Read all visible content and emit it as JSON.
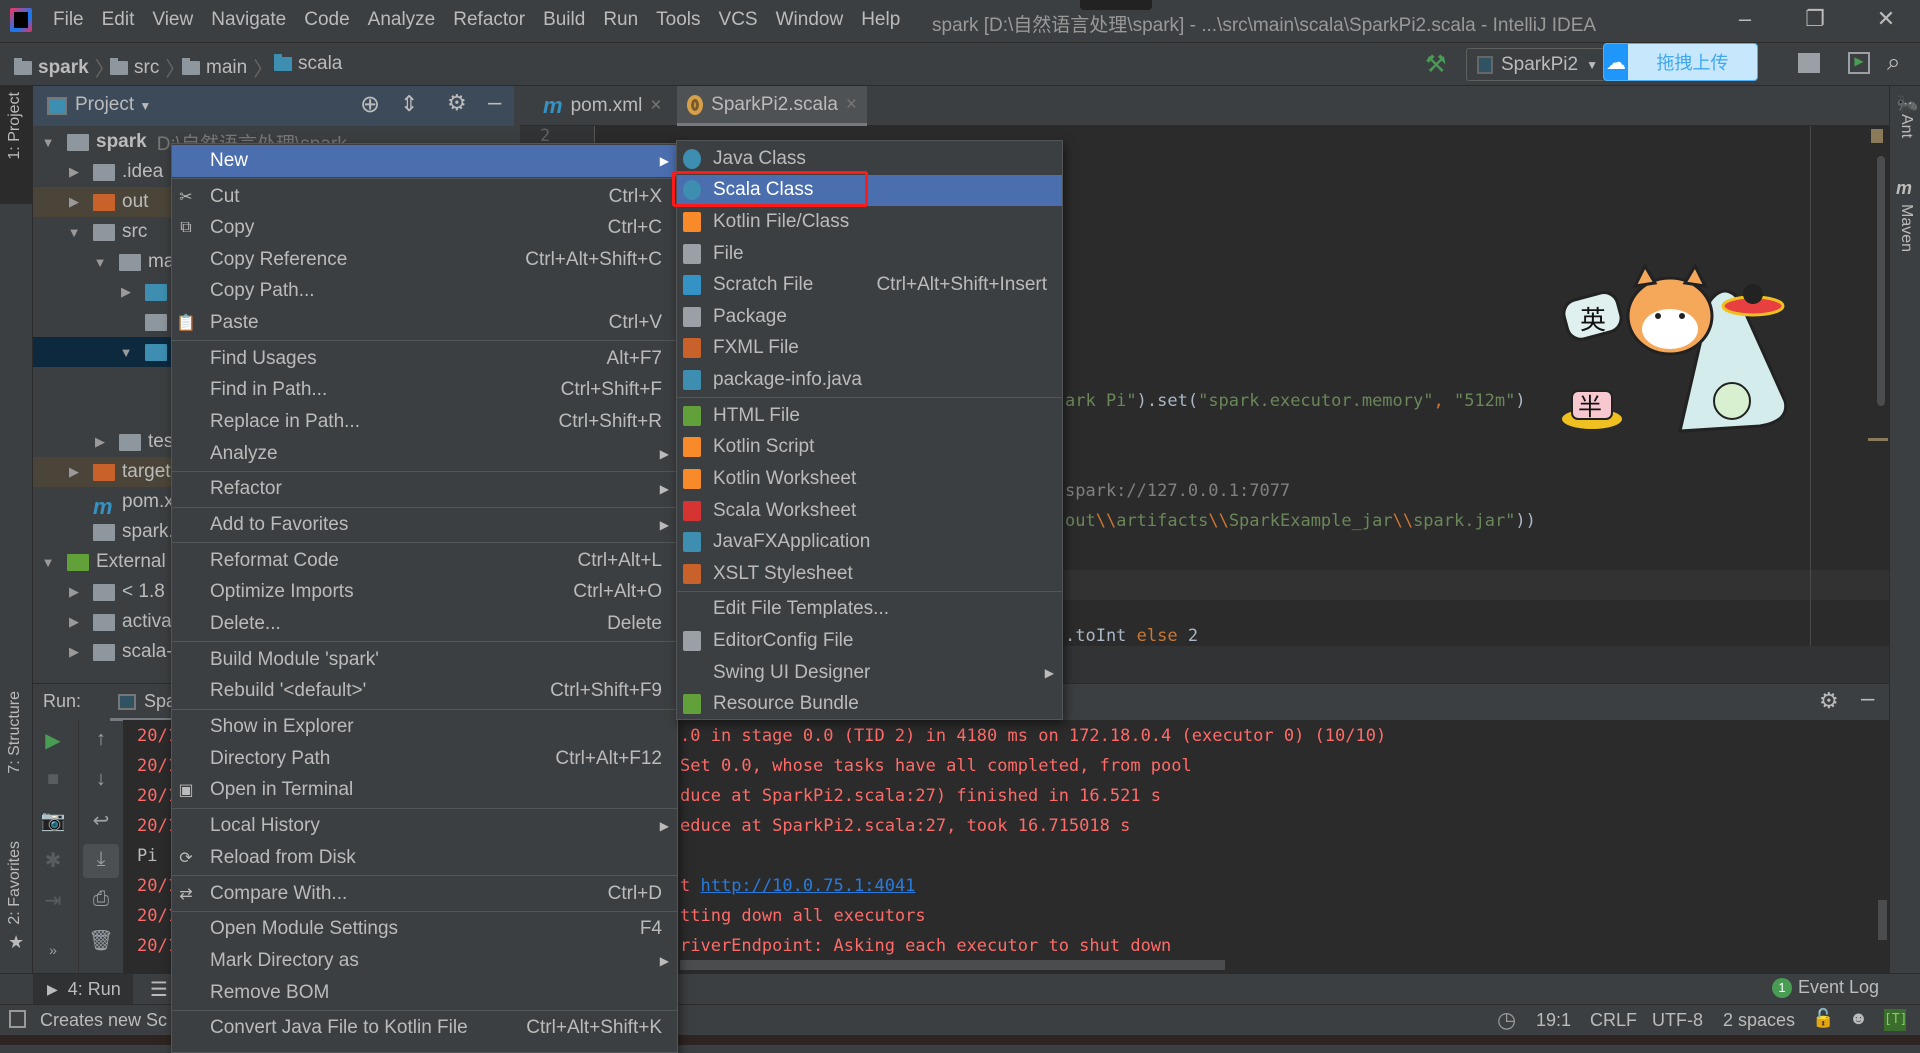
{
  "titlebar": {
    "menu": [
      "File",
      "Edit",
      "View",
      "Navigate",
      "Code",
      "Analyze",
      "Refactor",
      "Build",
      "Run",
      "Tools",
      "VCS",
      "Window",
      "Help"
    ],
    "title": "spark [D:\\自然语言处理\\spark] - ...\\src\\main\\scala\\SparkPi2.scala - IntelliJ IDEA",
    "controls": {
      "minimize": "–",
      "restore": "❐",
      "close": "✕"
    }
  },
  "navbar": {
    "breadcrumbs": [
      "spark",
      "src",
      "main",
      "scala"
    ],
    "run_config": "SparkPi2",
    "upload_button": "拖拽上传"
  },
  "left_stripe": {
    "project": "1: Project",
    "structure": "7: Structure",
    "favorites": "2: Favorites"
  },
  "right_stripe": {
    "ant": "Ant",
    "maven": "Maven"
  },
  "project_panel": {
    "title": "Project",
    "tree": [
      {
        "label": "spark",
        "suffix": "D:\\自然语言处理\\spark",
        "depth": 0,
        "expanded": true,
        "icon": "module-folder",
        "bold": true
      },
      {
        "label": ".idea",
        "depth": 1,
        "expanded": false,
        "icon": "folder"
      },
      {
        "label": "out",
        "depth": 1,
        "expanded": false,
        "icon": "excluded-folder",
        "excluded": true
      },
      {
        "label": "src",
        "depth": 1,
        "expanded": true,
        "icon": "folder"
      },
      {
        "label": "ma",
        "depth": 2,
        "expanded": true,
        "icon": "folder"
      },
      {
        "label": "",
        "depth": 3,
        "expanded": false,
        "icon": "source-folder"
      },
      {
        "label": "",
        "depth": 3,
        "icon": "resources-folder"
      },
      {
        "label": "",
        "depth": 3,
        "expanded": true,
        "icon": "source-folder",
        "selected": true
      },
      {
        "label": "",
        "depth": 4,
        "icon": "none"
      },
      {
        "label": "",
        "depth": 4,
        "icon": "none"
      },
      {
        "label": "tes",
        "depth": 2,
        "expanded": false,
        "icon": "folder"
      },
      {
        "label": "target",
        "depth": 1,
        "expanded": false,
        "icon": "excluded-folder",
        "excluded": true
      },
      {
        "label": "pom.xm",
        "depth": 1,
        "icon": "maven-file"
      },
      {
        "label": "spark.",
        "depth": 1,
        "icon": "iml-file"
      },
      {
        "label": "External L",
        "depth": 0,
        "expanded": true,
        "icon": "libraries"
      },
      {
        "label": "< 1.8 :",
        "depth": 1,
        "expanded": false,
        "icon": "jdk"
      },
      {
        "label": "activa",
        "depth": 1,
        "expanded": false,
        "icon": "library"
      },
      {
        "label": "scala-",
        "depth": 1,
        "expanded": false,
        "icon": "library"
      }
    ]
  },
  "editor": {
    "tabs": [
      {
        "label": "pom.xml",
        "icon": "maven-icon",
        "active": false
      },
      {
        "label": "SparkPi2.scala",
        "icon": "scala-object-icon",
        "active": true
      }
    ],
    "line_number": "2",
    "code_lines": [
      [
        {
          "t": "ark Pi\"",
          "k": "str"
        },
        {
          "t": ").set(",
          "k": ""
        },
        {
          "t": "\"spark.executor.memory\"",
          "k": "str"
        },
        {
          "t": ", ",
          "k": "kw"
        },
        {
          "t": "\"512m\"",
          "k": "str"
        },
        {
          "t": ")",
          "k": ""
        }
      ],
      [
        {
          "t": "spark://127.0.0.1:7077",
          "k": "cm"
        }
      ],
      [
        {
          "t": "out",
          "k": "str"
        },
        {
          "t": "\\\\",
          "k": "kw"
        },
        {
          "t": "artifacts",
          "k": "str"
        },
        {
          "t": "\\\\",
          "k": "kw"
        },
        {
          "t": "SparkExample_jar",
          "k": "str"
        },
        {
          "t": "\\\\",
          "k": "kw"
        },
        {
          "t": "spark.jar\"",
          "k": "str"
        },
        {
          "t": "))",
          "k": ""
        }
      ],
      [
        {
          "t": ".toInt ",
          "k": ""
        },
        {
          "t": "else ",
          "k": "kw"
        },
        {
          "t": "2",
          "k": ""
        }
      ]
    ],
    "mascot_text": [
      "英",
      "半"
    ]
  },
  "run_panel": {
    "label": "Run:",
    "tab": "Spa",
    "console_left": [
      "20/1",
      "20/1",
      "20/1",
      "20/1",
      "Pi :",
      "20/1",
      "20/1",
      "20/1"
    ],
    "console_right": [
      ".0 in stage 0.0 (TID 2) in 4180 ms on 172.18.0.4 (executor 0) (10/10)",
      "Set 0.0, whose tasks have all completed, from pool",
      "duce at SparkPi2.scala:27) finished in 16.521 s",
      "educe at SparkPi2.scala:27, took 16.715018 s",
      "",
      "t ",
      "tting down all executors",
      "riverEndpoint: Asking each executor to shut down"
    ],
    "console_link": "http://10.0.75.1:4041"
  },
  "bottom_bar": {
    "run_tab": "4: Run",
    "event_log": "Event Log",
    "event_count": "1"
  },
  "status_bar": {
    "message": "Creates new Sc",
    "position": "19:1",
    "line_sep": "CRLF",
    "encoding": "UTF-8",
    "indent": "2 spaces"
  },
  "context_menu": {
    "items": [
      {
        "label": "New",
        "submenu": true,
        "highlighted": true
      },
      {
        "sep": true
      },
      {
        "label": "Cut",
        "shortcut": "Ctrl+X",
        "icon": "✂"
      },
      {
        "label": "Copy",
        "shortcut": "Ctrl+C",
        "icon": "⧉"
      },
      {
        "label": "Copy Reference",
        "shortcut": "Ctrl+Alt+Shift+C"
      },
      {
        "label": "Copy Path..."
      },
      {
        "label": "Paste",
        "shortcut": "Ctrl+V",
        "icon": "📋"
      },
      {
        "sep": true
      },
      {
        "label": "Find Usages",
        "shortcut": "Alt+F7"
      },
      {
        "label": "Find in Path...",
        "shortcut": "Ctrl+Shift+F"
      },
      {
        "label": "Replace in Path...",
        "shortcut": "Ctrl+Shift+R"
      },
      {
        "label": "Analyze",
        "submenu": true
      },
      {
        "sep": true
      },
      {
        "label": "Refactor",
        "submenu": true
      },
      {
        "sep": true
      },
      {
        "label": "Add to Favorites",
        "submenu": true
      },
      {
        "sep": true
      },
      {
        "label": "Reformat Code",
        "shortcut": "Ctrl+Alt+L"
      },
      {
        "label": "Optimize Imports",
        "shortcut": "Ctrl+Alt+O"
      },
      {
        "label": "Delete...",
        "shortcut": "Delete"
      },
      {
        "sep": true
      },
      {
        "label": "Build Module 'spark'"
      },
      {
        "label": "Rebuild '<default>'",
        "shortcut": "Ctrl+Shift+F9"
      },
      {
        "sep": true
      },
      {
        "label": "Show in Explorer"
      },
      {
        "label": "Directory Path",
        "shortcut": "Ctrl+Alt+F12"
      },
      {
        "label": "Open in Terminal",
        "icon": "▣"
      },
      {
        "sep": true
      },
      {
        "label": "Local History",
        "submenu": true
      },
      {
        "label": "Reload from Disk",
        "icon": "⟳"
      },
      {
        "sep": true
      },
      {
        "label": "Compare With...",
        "shortcut": "Ctrl+D",
        "icon": "⇄"
      },
      {
        "sep": true
      },
      {
        "label": "Open Module Settings",
        "shortcut": "F4"
      },
      {
        "label": "Mark Directory as",
        "submenu": true
      },
      {
        "label": "Remove BOM"
      },
      {
        "sep": true
      },
      {
        "label": "Convert Java File to Kotlin File",
        "shortcut": "Ctrl+Alt+Shift+K"
      }
    ]
  },
  "new_submenu": {
    "items": [
      {
        "label": "Java Class",
        "icon": "java-class",
        "color": "#3d8eb0"
      },
      {
        "label": "Scala Class",
        "icon": "scala-class",
        "color": "#3d8eb0",
        "highlighted": true
      },
      {
        "label": "Kotlin File/Class",
        "icon": "kotlin-file",
        "color": "#f88a2a"
      },
      {
        "label": "File",
        "icon": "file",
        "color": "#9aa0a6"
      },
      {
        "label": "Scratch File",
        "shortcut": "Ctrl+Alt+Shift+Insert",
        "icon": "scratch-file",
        "color": "#3592c4"
      },
      {
        "label": "Package",
        "icon": "package",
        "color": "#9aa0a6"
      },
      {
        "label": "FXML File",
        "icon": "fxml-file",
        "color": "#c9612b"
      },
      {
        "label": "package-info.java",
        "icon": "java-file",
        "color": "#3d8eb0"
      },
      {
        "sep": true
      },
      {
        "label": "HTML File",
        "icon": "html-file",
        "color": "#62a03a"
      },
      {
        "label": "Kotlin Script",
        "icon": "kotlin-script",
        "color": "#f88a2a"
      },
      {
        "label": "Kotlin Worksheet",
        "icon": "kotlin-worksheet",
        "color": "#f88a2a"
      },
      {
        "label": "Scala Worksheet",
        "icon": "scala-worksheet",
        "color": "#d63333"
      },
      {
        "label": "JavaFXApplication",
        "icon": "java-file",
        "color": "#3d8eb0"
      },
      {
        "label": "XSLT Stylesheet",
        "icon": "xslt-file",
        "color": "#c9612b"
      },
      {
        "sep": true
      },
      {
        "label": "Edit File Templates..."
      },
      {
        "label": "EditorConfig File",
        "icon": "gear",
        "color": "#9aa0a6"
      },
      {
        "label": "Swing UI Designer",
        "submenu": true
      },
      {
        "label": "Resource Bundle",
        "icon": "resource-bundle",
        "color": "#62a03a"
      }
    ]
  },
  "colors": {
    "accent": "#4b6eaf",
    "highlight_box": "#ff1a1a",
    "console_error": "#ff6b68",
    "link": "#287bde",
    "string": "#6a8759",
    "keyword": "#cc7832"
  }
}
